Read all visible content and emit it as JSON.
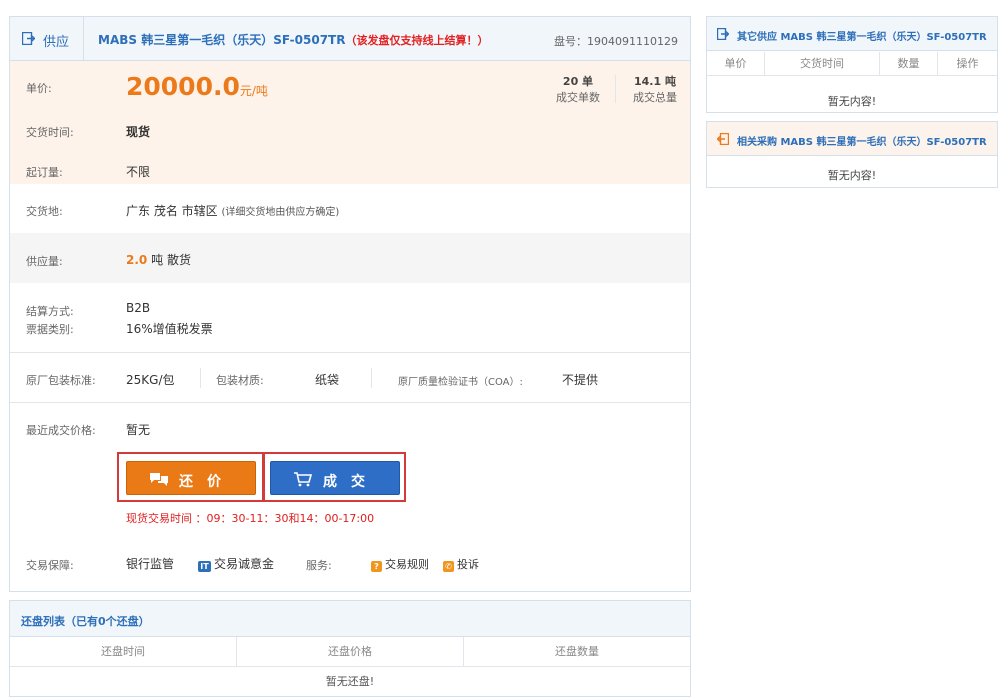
{
  "header": {
    "tab_label": "供应",
    "product_title": "MABS 韩三星第一毛织（乐天）SF-0507TR",
    "notice": "（该发盘仅支持线上结算！）",
    "offer_no_label": "盘号：",
    "offer_no": "1904091110129"
  },
  "price": {
    "label": "单价:",
    "value": "20000.0",
    "unit": "元/吨"
  },
  "stats": {
    "orders_value": "20 单",
    "orders_label": "成交单数",
    "total_value": "14.1 吨",
    "total_label": "成交总量"
  },
  "trade_time": {
    "label": "交货时间:",
    "value": "现货"
  },
  "min_order": {
    "label": "起订量:",
    "value": "不限"
  },
  "delivery": {
    "label": "交货地:",
    "value": "广东 茂名 市辖区",
    "note": "(详细交货地由供应方确定)"
  },
  "supply": {
    "label": "供应量:",
    "amount": "2.0",
    "unit": "吨",
    "type": "散货"
  },
  "settlement": {
    "label": "结算方式:",
    "value": "B2B"
  },
  "invoice": {
    "label": "票据类别:",
    "value": "16%增值税发票"
  },
  "packaging": {
    "std_label": "原厂包装标准:",
    "std_value": "25KG/包",
    "material_label": "包装材质:",
    "material_value": "纸袋",
    "coa_label": "原厂质量检验证书（COA）:",
    "coa_value": "不提供"
  },
  "recent_price": {
    "label": "最近成交价格:",
    "value": "暂无"
  },
  "actions": {
    "counter_offer": "还价",
    "deal": "成交",
    "hours": "现货交易时间 ：09：30-11：30和14：00-17:00"
  },
  "guarantee": {
    "label": "交易保障:",
    "bank": "银行监管",
    "deposit_badge": "IT",
    "deposit": "交易诚意金",
    "service_label": "服务:",
    "rules": "交易规则",
    "complaint": "投诉"
  },
  "counter_list": {
    "title": "还盘列表（已有0个还盘）",
    "columns": [
      "还盘时间",
      "还盘价格",
      "还盘数量"
    ],
    "empty": "暂无还盘!"
  },
  "other_supply": {
    "title": "其它供应 MABS 韩三星第一毛织（乐天）SF-0507TR",
    "columns": [
      "单价",
      "交货时间",
      "数量",
      "操作"
    ],
    "empty": "暂无内容!"
  },
  "related_purchase": {
    "title": "相关采购 MABS 韩三星第一毛织（乐天）SF-0507TR",
    "empty": "暂无内容!"
  },
  "colors": {
    "accent_blue": "#2d6fb8",
    "price_orange": "#ec7a1a",
    "alert_red": "#e22222",
    "highlight_bg": "#fdf3ea"
  }
}
